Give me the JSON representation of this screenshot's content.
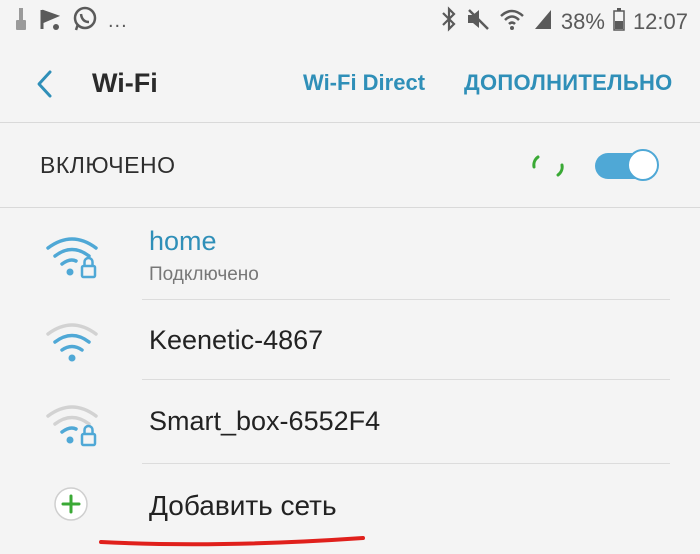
{
  "status_bar": {
    "battery_percent": "38%",
    "time": "12:07",
    "overflow": "..."
  },
  "toolbar": {
    "title": "Wi-Fi",
    "wifi_direct_label": "Wi-Fi Direct",
    "more_label": "ДОПОЛНИТЕЛЬНО"
  },
  "wifi_switch": {
    "label": "ВКЛЮЧЕНО",
    "on": true
  },
  "networks": [
    {
      "name": "home",
      "status": "Подключено",
      "secured": true,
      "connected": true
    },
    {
      "name": "Keenetic-4867",
      "status": "",
      "secured": false,
      "connected": false
    },
    {
      "name": "Smart_box-6552F4",
      "status": "",
      "secured": true,
      "connected": false
    }
  ],
  "add_network": {
    "label": "Добавить сеть"
  },
  "colors": {
    "accent": "#2f8fb8",
    "toggle": "#4fa8d6",
    "add_green": "#3aa935",
    "underline_red": "#e0201c"
  }
}
